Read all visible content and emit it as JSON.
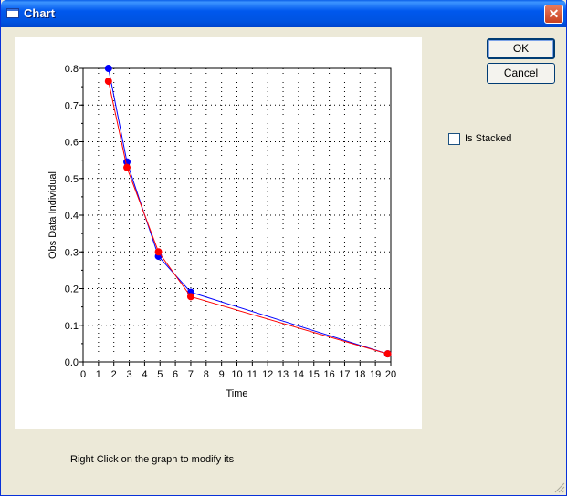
{
  "window": {
    "title": "Chart",
    "title_icon": "window-icon"
  },
  "buttons": {
    "ok": "OK",
    "cancel": "Cancel"
  },
  "options": {
    "is_stacked_label": "Is Stacked",
    "is_stacked_checked": false
  },
  "status_text": "Right Click on the graph to modify its",
  "chart_data": {
    "type": "line",
    "xlabel": "Time",
    "ylabel": "Obs Data Individual",
    "xlim": [
      0,
      20
    ],
    "ylim": [
      0,
      0.8
    ],
    "x_ticks": [
      0,
      1,
      2,
      3,
      4,
      5,
      6,
      7,
      8,
      9,
      10,
      11,
      12,
      13,
      14,
      15,
      16,
      17,
      18,
      19,
      20
    ],
    "y_ticks": [
      0.0,
      0.1,
      0.2,
      0.3,
      0.4,
      0.5,
      0.6,
      0.7,
      0.8
    ],
    "grid": true,
    "series": [
      {
        "color": "#0000FF",
        "x": [
          1.65,
          2.85,
          4.9,
          7.0,
          19.8
        ],
        "y": [
          0.8,
          0.545,
          0.288,
          0.19,
          0.022
        ]
      },
      {
        "color": "#FF0000",
        "x": [
          1.65,
          2.85,
          4.9,
          7.0,
          19.8
        ],
        "y": [
          0.765,
          0.53,
          0.3,
          0.178,
          0.022
        ]
      }
    ]
  }
}
